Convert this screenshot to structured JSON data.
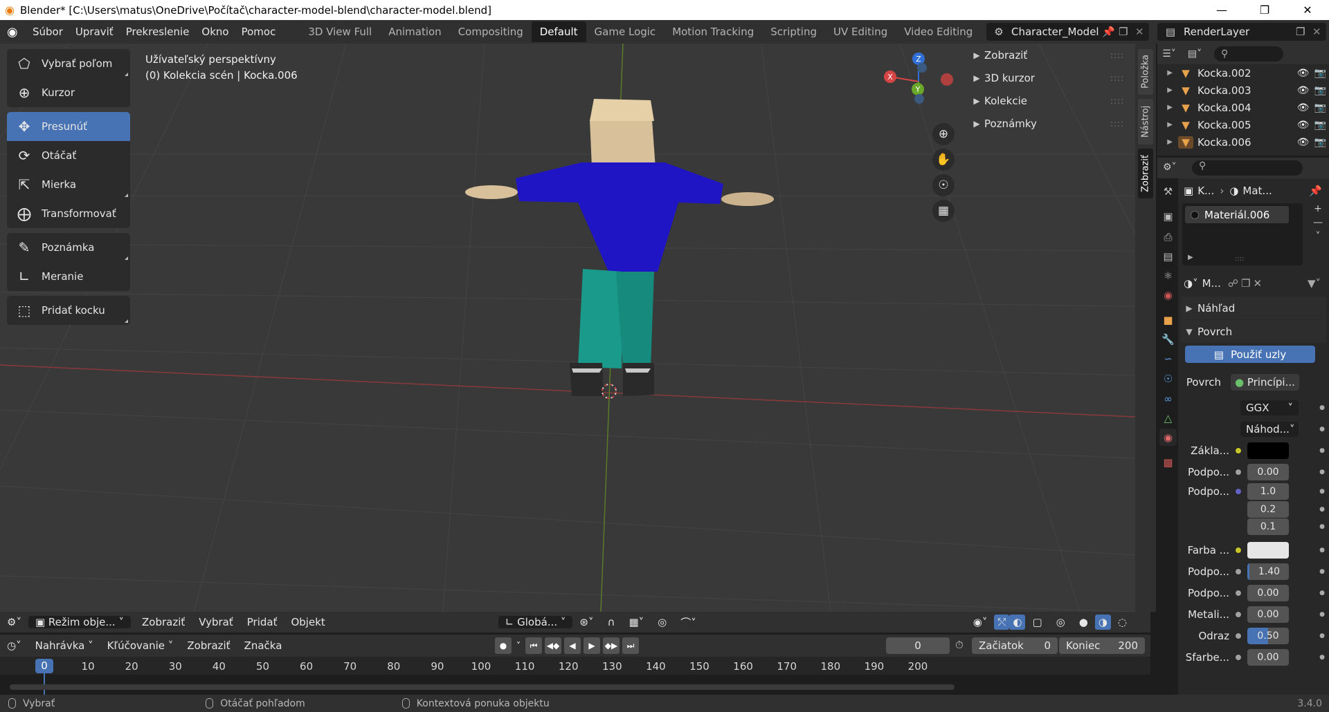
{
  "titlebar": {
    "title": "Blender* [C:\\Users\\matus\\OneDrive\\Počítač\\character-model-blend\\character-model.blend]"
  },
  "menu": {
    "items": [
      "Súbor",
      "Upraviť",
      "Prekreslenie",
      "Okno",
      "Pomoc"
    ]
  },
  "workspaces": {
    "tabs": [
      "3D View Full",
      "Animation",
      "Compositing",
      "Default",
      "Game Logic",
      "Motion Tracking",
      "Scripting",
      "UV Editing",
      "Video Editing"
    ],
    "active": "Default"
  },
  "scene": {
    "name": "Character_Model"
  },
  "view_layer": {
    "name": "RenderLayer"
  },
  "viewport": {
    "info_line1": "Užívateľský perspektívny",
    "info_line2": "(0) Kolekcia scén | Kocka.006",
    "tools": [
      "Vybrať poľom",
      "Kurzor",
      "Presunúť",
      "Otáčať",
      "Mierka",
      "Transformovať",
      "Poznámka",
      "Meranie",
      "Pridať kocku"
    ],
    "active_tool": "Presunúť",
    "gizmo": {
      "z": "Z",
      "x": "X",
      "y": "Y"
    },
    "npanel": [
      "Zobraziť",
      "3D kurzor",
      "Kolekcie",
      "Poznámky"
    ],
    "side_tabs": [
      "Položka",
      "Nástroj",
      "Zobraziť"
    ]
  },
  "vp_header": {
    "mode": "Režim obje...",
    "menus": [
      "Zobraziť",
      "Vybrať",
      "Pridať",
      "Objekt"
    ],
    "orientation": "Globá..."
  },
  "timeline": {
    "menus": [
      "Nahrávka",
      "Kľúčovanie",
      "Zobraziť",
      "Značka"
    ],
    "current_frame": "0",
    "start_label": "Začiatok",
    "start": "0",
    "end_label": "Koniec",
    "end": "200",
    "ticks": [
      "0",
      "10",
      "20",
      "30",
      "40",
      "50",
      "60",
      "70",
      "80",
      "90",
      "100",
      "110",
      "120",
      "130",
      "140",
      "150",
      "160",
      "170",
      "180",
      "190",
      "200"
    ]
  },
  "statusbar": {
    "items": [
      "Vybrať",
      "Otáčať pohľadom",
      "Kontextová ponuka objektu"
    ],
    "version": "3.4.0"
  },
  "outliner": {
    "items": [
      "Kocka.002",
      "Kocka.003",
      "Kocka.004",
      "Kocka.005",
      "Kocka.006"
    ]
  },
  "properties": {
    "crumb_object": "K...",
    "crumb_material": "Mat...",
    "slot": "Materiál.006",
    "mat_name": "M...",
    "sections": {
      "preview": "Náhľad",
      "surface": "Povrch"
    },
    "use_nodes": "Použiť uzly",
    "surface_label": "Povrch",
    "surface_value": "Princípi...",
    "distribution": "GGX",
    "subsurface_method": "Náhod...",
    "rows": [
      {
        "label": "Zákla...",
        "value": ""
      },
      {
        "label": "Podpo...",
        "value": "0.00"
      },
      {
        "label": "Podpo...",
        "value": "1.0"
      },
      {
        "label": "",
        "value": "0.2"
      },
      {
        "label": "",
        "value": "0.1"
      },
      {
        "label": "Farba ...",
        "value": ""
      },
      {
        "label": "Podpo...",
        "value": "1.40"
      },
      {
        "label": "Podpo...",
        "value": "0.00"
      },
      {
        "label": "Metali...",
        "value": "0.00"
      },
      {
        "label": "Odraz",
        "value": "0.50"
      },
      {
        "label": "Sfarbe...",
        "value": "0.00"
      }
    ]
  },
  "colors": {
    "accent": "#4772b3",
    "shirt": "#1f15c4",
    "pants": "#1a9a8a",
    "skin": "#d8c09a",
    "shoes": "#2a2a2a"
  }
}
